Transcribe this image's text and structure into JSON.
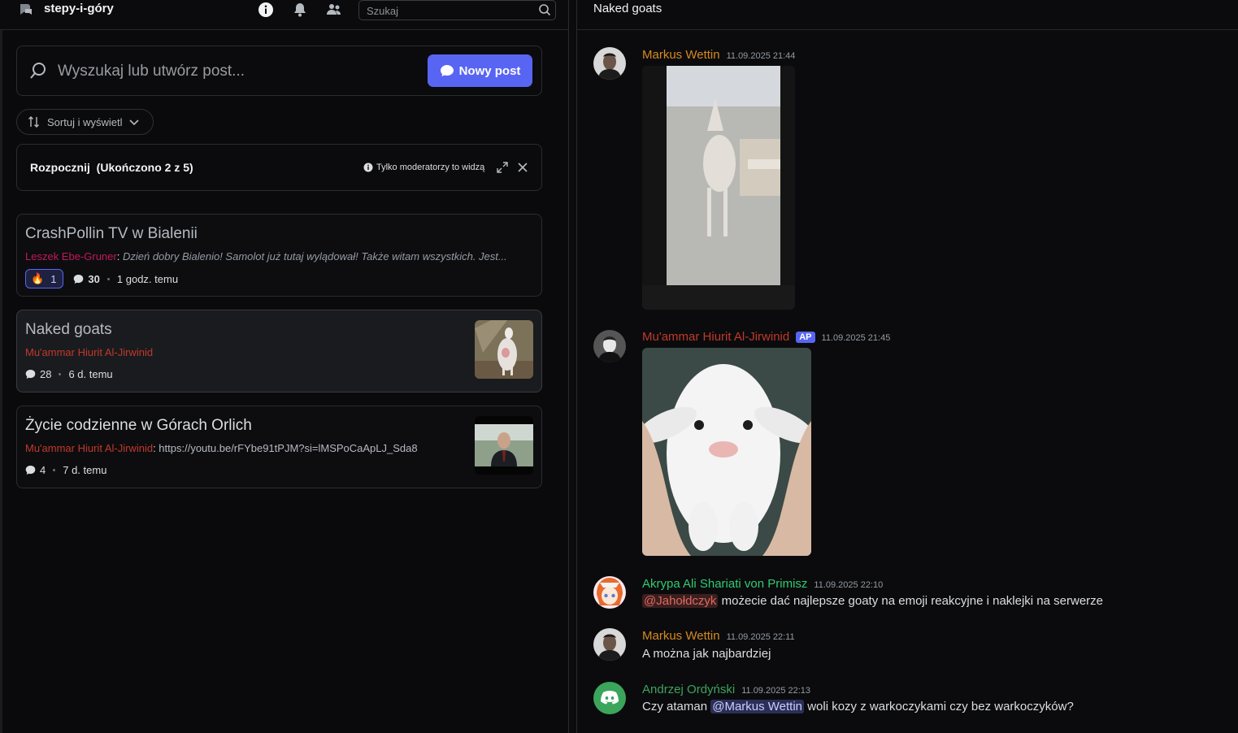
{
  "left": {
    "channel_name": "stepy-i-góry",
    "search_placeholder": "Szukaj",
    "create_placeholder": "Wyszukaj lub utwórz post...",
    "new_post_label": "Nowy post",
    "sort_label": "Sortuj i wyświetl",
    "onboarding": {
      "title": "Rozpocznij",
      "progress": "(Ukończono 2 z 5)",
      "mods_only": "Tylko moderatorzy to widzą"
    },
    "posts": [
      {
        "title": "CrashPollin TV w Bialenii",
        "author": "Leszek Ebe-Gruner",
        "author_color": "#c2185b",
        "preview": "Dzień dobry Bialenio! Samolot już tutaj wylądował! Także witam wszystkich. Jest...",
        "reaction_emoji": "🔥",
        "reaction_count": "1",
        "comments": "30",
        "time": "1 godz. temu"
      },
      {
        "title": "Naked goats",
        "author": "Mu'ammar Hiurit Al-Jirwinid",
        "author_color": "#c0392b",
        "preview": "",
        "comments": "28",
        "time": "6 d. temu"
      },
      {
        "title": "Życie codzienne w Górach Orlich",
        "author": "Mu'ammar Hiurit Al-Jirwinid",
        "author_color": "#c0392b",
        "preview": "https://youtu.be/rFYbe91tPJM?si=lMSPoCaApLJ_Sda8",
        "comments": "4",
        "time": "7 d. temu"
      }
    ]
  },
  "right": {
    "thread_title": "Naked goats",
    "messages": [
      {
        "user": "Markus Wettin",
        "color": "#d68a1f",
        "time": "11.09.2025 21:44",
        "text": ""
      },
      {
        "user": "Mu'ammar Hiurit Al-Jirwinid",
        "color": "#c0392b",
        "tag": "AP",
        "time": "11.09.2025 21:45",
        "text": ""
      },
      {
        "user": "Akrypa Ali Shariati von Primisz",
        "color": "#2ecc71",
        "time": "11.09.2025 22:10",
        "mention": "@Jahołdczyk",
        "text": "możecie dać najlepsze goaty na emoji reakcyjne i naklejki na serwerze"
      },
      {
        "user": "Markus Wettin",
        "color": "#d68a1f",
        "time": "11.09.2025 22:11",
        "text": "A można jak najbardziej"
      },
      {
        "user": "Andrzej Ordyński",
        "color": "#3ba55c",
        "time": "11.09.2025 22:13",
        "text_before": "Czy ataman",
        "mention": "@Markus Wettin",
        "text_after": "woli kozy z warkoczykami czy bez warkoczyków?"
      }
    ]
  }
}
